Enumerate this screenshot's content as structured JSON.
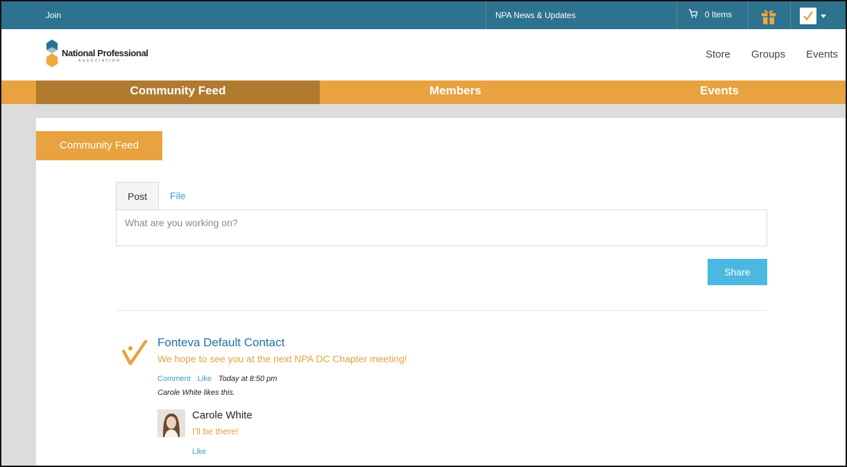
{
  "topbar": {
    "join": "Join",
    "news": "NPA News & Updates",
    "cart_label": "0 Items"
  },
  "header": {
    "logo_title": "National Professional",
    "logo_subtitle": "ASSOCIATION",
    "nav": [
      "Store",
      "Groups",
      "Events"
    ]
  },
  "tabs": {
    "community_feed": "Community Feed",
    "members": "Members",
    "events": "Events"
  },
  "feed": {
    "section_label": "Community Feed",
    "post_tab": "Post",
    "file_tab": "File",
    "input_placeholder": "What are you working on?",
    "share_label": "Share"
  },
  "post": {
    "author": "Fonteva Default Contact",
    "text": "We hope to see you at the next NPA DC Chapter meeting!",
    "comment_label": "Comment",
    "like_label": "Like",
    "time": "Today at 8:50 pm",
    "likes_text": "Carole White likes this."
  },
  "reply": {
    "author": "Carole White",
    "text": "I'll be there!",
    "like_label": "Like"
  },
  "colors": {
    "topbar": "#2d7390",
    "accent_orange": "#e8a23f",
    "active_tab": "#b07a2f",
    "share_button": "#4db8df",
    "link_blue": "#3a9ccf"
  },
  "icons": [
    "cart-icon",
    "gift-icon",
    "checkmark-logo-icon",
    "caret-down-icon",
    "hexagon-logo-icon"
  ]
}
